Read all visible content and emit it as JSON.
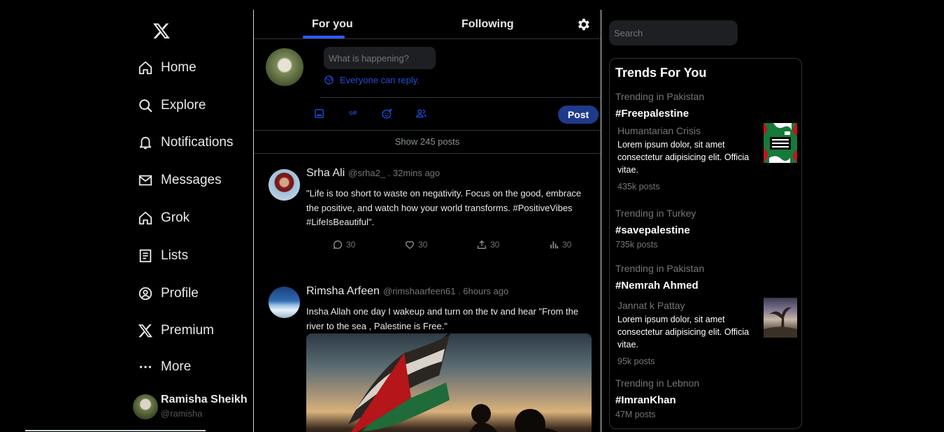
{
  "nav": {
    "items": [
      {
        "label": "Home",
        "icon": "home-icon"
      },
      {
        "label": "Explore",
        "icon": "search-icon"
      },
      {
        "label": "Notifications",
        "icon": "bell-icon"
      },
      {
        "label": "Messages",
        "icon": "mail-icon"
      },
      {
        "label": "Grok",
        "icon": "grok-icon"
      },
      {
        "label": "Lists",
        "icon": "list-icon"
      },
      {
        "label": "Profile",
        "icon": "profile-icon"
      },
      {
        "label": "Premium",
        "icon": "x-logo-icon"
      },
      {
        "label": "More",
        "icon": "more-icon"
      }
    ]
  },
  "account": {
    "name": "Ramisha Sheikh",
    "handle": "@ramisha"
  },
  "tabs": {
    "for_you": "For you",
    "following": "Following"
  },
  "composer": {
    "placeholder": "What is happening?",
    "reply_setting": "Everyone can reply.",
    "gif_label": "GIF",
    "post_label": "Post"
  },
  "feed": {
    "show_posts": "Show 245 posts",
    "tweets": [
      {
        "name": "Srha Ali",
        "meta": "@srha2_ . 32mins ago",
        "text": "\"Life is too short to waste on negativity. Focus on the good, embrace the positive, and watch how your world transforms. #PositiveVibes #LifeIsBeautiful\".",
        "replies": "30",
        "likes": "30",
        "shares": "30",
        "views": "30"
      },
      {
        "name": "Rimsha Arfeen",
        "meta": "@rimshaarfeen61 . 6hours ago",
        "text": "Insha Allah one day I wakeup and turn on the tv and hear \"From the river to the sea , Palestine is Free.\""
      }
    ]
  },
  "search": {
    "placeholder": "Search"
  },
  "trends": {
    "title": "Trends For You",
    "items": [
      {
        "location": "Trending in Pakistan",
        "tag": "#Freepalestine",
        "subtitle": "Humantarian Crisis",
        "description": "Lorem ipsum dolor, sit amet consectetur adipisicing elit. Officia vitae.",
        "posts": "435k posts"
      },
      {
        "location": "Trending in Turkey",
        "tag": "#savepalestine",
        "posts": "735k posts"
      },
      {
        "location": "Trending in Pakistan",
        "tag": "#Nemrah Ahmed",
        "subtitle": "Jannat k Pattay",
        "description": "Lorem ipsum dolor, sit amet consectetur adipisicing elit. Officia vitae.",
        "posts": "95k posts"
      },
      {
        "location": "Trending in Lebnon",
        "tag": "#ImranKhan",
        "posts": "47M posts"
      }
    ]
  },
  "colors": {
    "accent": "#1d4ed8",
    "post_button": "#1f3a8a",
    "tab_underline": "#2f5cff",
    "background": "#000000"
  }
}
